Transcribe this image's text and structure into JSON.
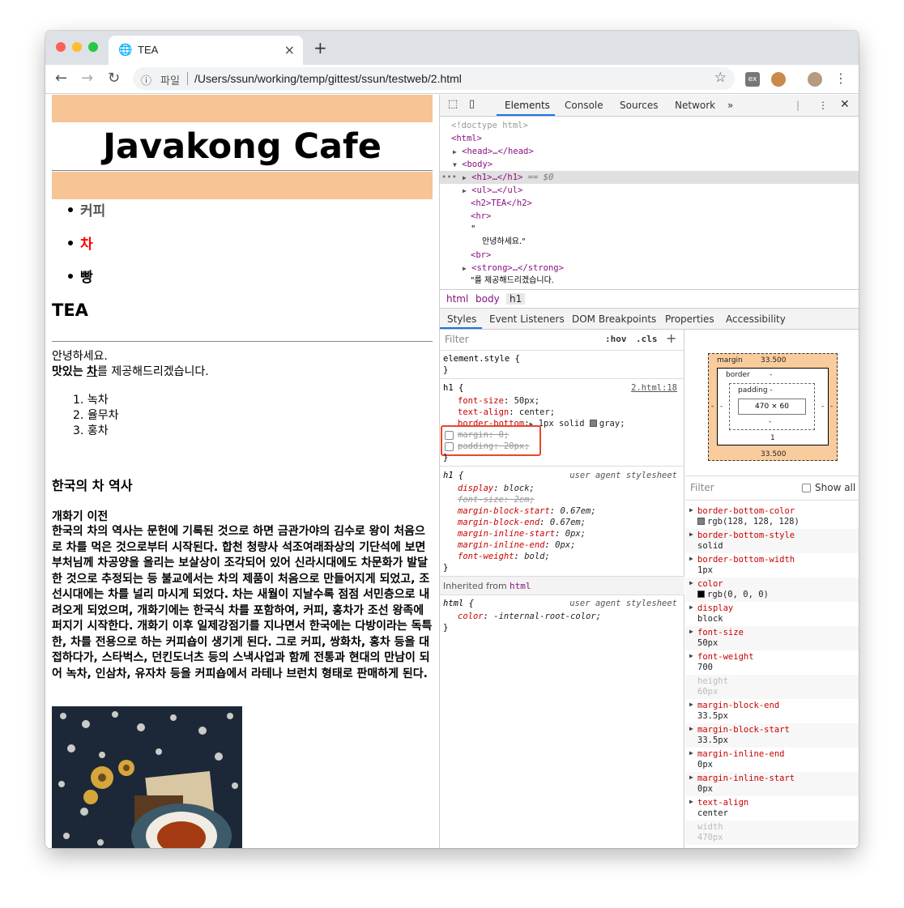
{
  "browser": {
    "tab_title": "TEA",
    "address_label": "파일",
    "url": "/Users/ssun/working/temp/gittest/ssun/testweb/2.html"
  },
  "page": {
    "heading": "Javakong Cafe",
    "menu": [
      {
        "label": "커피",
        "color": "#555555"
      },
      {
        "label": "차",
        "color": "#ff0000"
      },
      {
        "label": "빵",
        "color": "#000000"
      }
    ],
    "subtitle": "TEA",
    "greeting": "안녕하세요.",
    "offer": {
      "strong": "맛있는",
      "link": "차",
      "rest": "를 제공해드리겠습니다."
    },
    "tea_list": [
      "녹차",
      "율무차",
      "홍차"
    ],
    "history_title": "한국의 차 역사",
    "era_title": "개화기 이전",
    "history_text": "한국의 차의 역사는 문헌에 기록된 것으로 하면 금관가야의 김수로 왕이 처음으로 차를 먹은 것으로부터 시작된다. 합천 청량사 석조여래좌상의 기단석에 보면 부처님께 차공양을 올리는 보살상이 조각되어 있어 신라시대에도 차문화가 발달한 것으로 추정되는 등 불교에서는 차의 제품이 처음으로 만들어지게 되었고, 조선시대에는 차를 널리 마시게 되었다. 차는 새월이 지날수록 점점 서민층으로 내려오게 되었으며, 개화기에는 한국식 차를 포함하여, 커피, 홍차가 조선 왕족에 퍼지기 시작한다. 개화기 이후 일제강점기를 지나면서 한국에는 다방이라는 독특한, 차를 전용으로 하는 커피숍이 생기게 된다. 그로 커피, 쌍화차, 홍차 등을 대접하다가, 스타벅스, 던킨도너츠 등의 스낵사업과 함께 전통과 현대의 만남이 되어 녹차, 인삼차, 유자차 등을 커피숍에서 라테나 브런치 형태로 판매하게 된다."
  },
  "devtools": {
    "tabs": [
      "Elements",
      "Console",
      "Sources",
      "Network",
      "»"
    ],
    "dom": {
      "doctype": "<!doctype html>",
      "html_open": "<html>",
      "head": "<head>…</head>",
      "body_open": "<body>",
      "h1": "<h1>…</h1>",
      "h1_marker": "== $0",
      "ul": "<ul>…</ul>",
      "h2": "<h2>TEA</h2>",
      "hr": "<hr>",
      "quote_open": "\"",
      "text_greeting": "안녕하세요.\"",
      "br": "<br>",
      "strong": "<strong>…</strong>",
      "text_offer": "\"를 제공해드리겠습니다."
    },
    "breadcrumbs": [
      "html",
      "body",
      "h1"
    ],
    "panel_tabs": [
      "Styles",
      "Event Listeners",
      "DOM Breakpoints",
      "Properties",
      "Accessibility"
    ],
    "filter_placeholder": "Filter",
    "hov": ":hov",
    "cls": ".cls",
    "plus": "+",
    "styles": {
      "element_style": "element.style {",
      "close": "}",
      "h1_selector": "h1 {",
      "h1_source": "2.html:18",
      "font_size": {
        "prop": "font-size",
        "val": "50px;"
      },
      "text_align": {
        "prop": "text-align",
        "val": "center;"
      },
      "border_bottom": {
        "prop": "border-bottom",
        "val": "1px solid",
        "color_val": "gray;"
      },
      "margin": {
        "prop": "margin",
        "val": "0;"
      },
      "padding": {
        "prop": "padding",
        "val": "20px;"
      },
      "ua_selector": "h1 {",
      "ua_source": "user agent stylesheet",
      "ua_props": [
        {
          "prop": "display",
          "val": "block;",
          "struck": false
        },
        {
          "prop": "font-size",
          "val": "2em;",
          "struck": true
        },
        {
          "prop": "margin-block-start",
          "val": "0.67em;",
          "struck": false
        },
        {
          "prop": "margin-block-end",
          "val": "0.67em;",
          "struck": false
        },
        {
          "prop": "margin-inline-start",
          "val": "0px;",
          "struck": false
        },
        {
          "prop": "margin-inline-end",
          "val": "0px;",
          "struck": false
        },
        {
          "prop": "font-weight",
          "val": "bold;",
          "struck": false
        }
      ],
      "inherited_label": "Inherited from",
      "inherited_from": "html",
      "html_selector": "html {",
      "html_source": "user agent stylesheet",
      "html_prop": {
        "prop": "color",
        "val": "-internal-root-color;"
      }
    },
    "box_model": {
      "margin_label": "margin",
      "margin_value": "33.500",
      "margin_bottom": "33.500",
      "border_label": "border",
      "border_value": "-",
      "padding_label": "padding -",
      "content": "470 × 60",
      "dash": "-",
      "border_bottom": "1"
    },
    "computed_filter": "Filter",
    "show_all": "Show all",
    "computed": [
      {
        "name": "border-bottom-color",
        "value": "rgb(128, 128, 128)",
        "swatch": "#808080",
        "dim": false
      },
      {
        "name": "border-bottom-style",
        "value": "solid",
        "dim": false
      },
      {
        "name": "border-bottom-width",
        "value": "1px",
        "dim": false
      },
      {
        "name": "color",
        "value": "rgb(0, 0, 0)",
        "swatch": "#000000",
        "dim": false
      },
      {
        "name": "display",
        "value": "block",
        "dim": false
      },
      {
        "name": "font-size",
        "value": "50px",
        "dim": false
      },
      {
        "name": "font-weight",
        "value": "700",
        "dim": false
      },
      {
        "name": "height",
        "value": "60px",
        "dim": true
      },
      {
        "name": "margin-block-end",
        "value": "33.5px",
        "dim": false
      },
      {
        "name": "margin-block-start",
        "value": "33.5px",
        "dim": false
      },
      {
        "name": "margin-inline-end",
        "value": "0px",
        "dim": false
      },
      {
        "name": "margin-inline-start",
        "value": "0px",
        "dim": false
      },
      {
        "name": "text-align",
        "value": "center",
        "dim": false
      },
      {
        "name": "width",
        "value": "470px",
        "dim": true
      }
    ]
  }
}
